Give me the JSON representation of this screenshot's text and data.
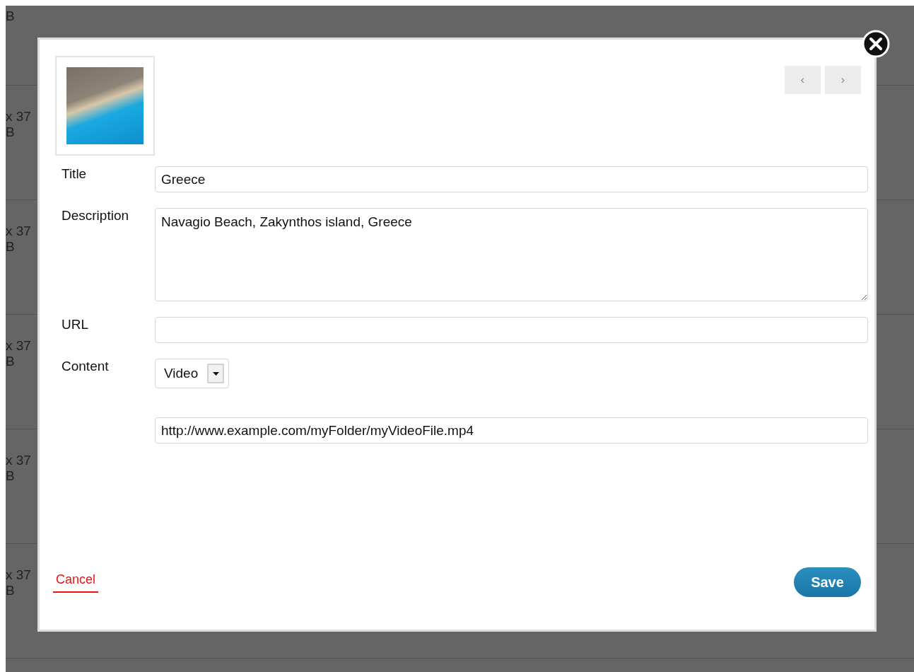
{
  "background": {
    "rows": [
      {
        "lines": [
          "B"
        ]
      },
      {
        "lines": [
          "x 37",
          "B"
        ]
      },
      {
        "lines": [
          "x 37",
          "B"
        ]
      },
      {
        "lines": [
          "x 37",
          "B"
        ]
      },
      {
        "lines": [
          "x 37",
          "B"
        ]
      },
      {
        "lines": [
          "x 37",
          "B"
        ]
      }
    ]
  },
  "dialog": {
    "nav": [
      "‹",
      "›"
    ],
    "fields": [
      {
        "kind": "input",
        "label": "Title",
        "value": "Greece"
      },
      {
        "kind": "textarea",
        "label": "Description",
        "value": "Navagio Beach, Zakynthos island, Greece"
      },
      {
        "kind": "input",
        "label": "URL"
      },
      {
        "kind": "select",
        "label": "Content",
        "value": "Video"
      },
      {
        "kind": "input",
        "value": "http://www.example.com/myFolder/myVideoFile.mp4"
      }
    ],
    "cancel": "Cancel",
    "save": "Save"
  }
}
